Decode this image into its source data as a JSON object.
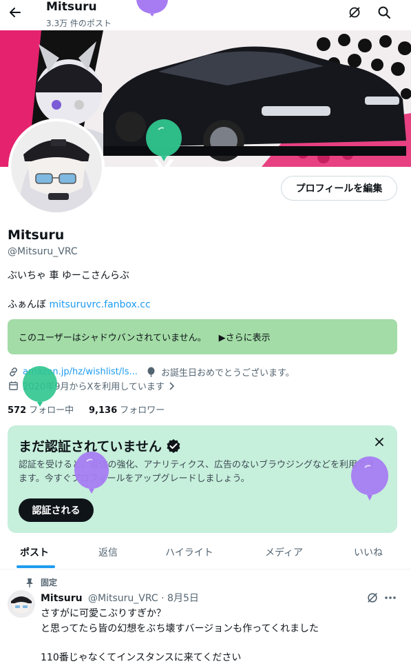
{
  "header": {
    "name": "Mitsuru",
    "post_count": "3.3万 件のポスト",
    "icons": [
      "back-arrow-icon",
      "grok-icon",
      "search-icon"
    ]
  },
  "profile": {
    "edit_button": "プロフィールを編集",
    "name": "Mitsuru",
    "handle": "@Mitsuru_VRC",
    "bio_line1": "ぶいちゃ 車 ゆーこさんらぶ",
    "bio_prefix": "ふぁんぼ",
    "bio_link": "mitsuruvrc.fanbox.cc",
    "shadowban_text": "このユーザーはシャドウバンされていません。",
    "shadowban_more": "▶さらに表示",
    "website": "amazon.jp/hz/wishlist/ls...",
    "birthday": "お誕生日おめでとうございます。",
    "joined": "2020年9月からXを利用しています",
    "following_count": "572",
    "following_label": "フォロー中",
    "followers_count": "9,136",
    "followers_label": "フォロワー"
  },
  "verify_card": {
    "title": "まだ認証されていません",
    "body": "認証を受けると、返信の強化、アナリティクス、広告のないブラウジングなどを利用できます。今すぐプロフィールをアップグレードしましょう。",
    "button": "認証される"
  },
  "tabs": [
    "ポスト",
    "返信",
    "ハイライト",
    "メディア",
    "いいね"
  ],
  "pinned_post": {
    "pinned_label": "固定",
    "author": "Mitsuru",
    "handle": "@Mitsuru_VRC",
    "date": "8月5日",
    "line1": "さすがに可愛こぶりすぎか？",
    "line2": "と思ってたら皆の幻想をぶち壊すバージョンも作ってくれました",
    "line3": "110番じゃなくてインスタンスに来てください"
  },
  "colors": {
    "accent": "#1d9bf0",
    "shadowban_bg": "#a3dca6",
    "verify_bg": "#c6efdc",
    "balloon_purple": "#a77cf2",
    "balloon_green": "#2fc58f"
  }
}
